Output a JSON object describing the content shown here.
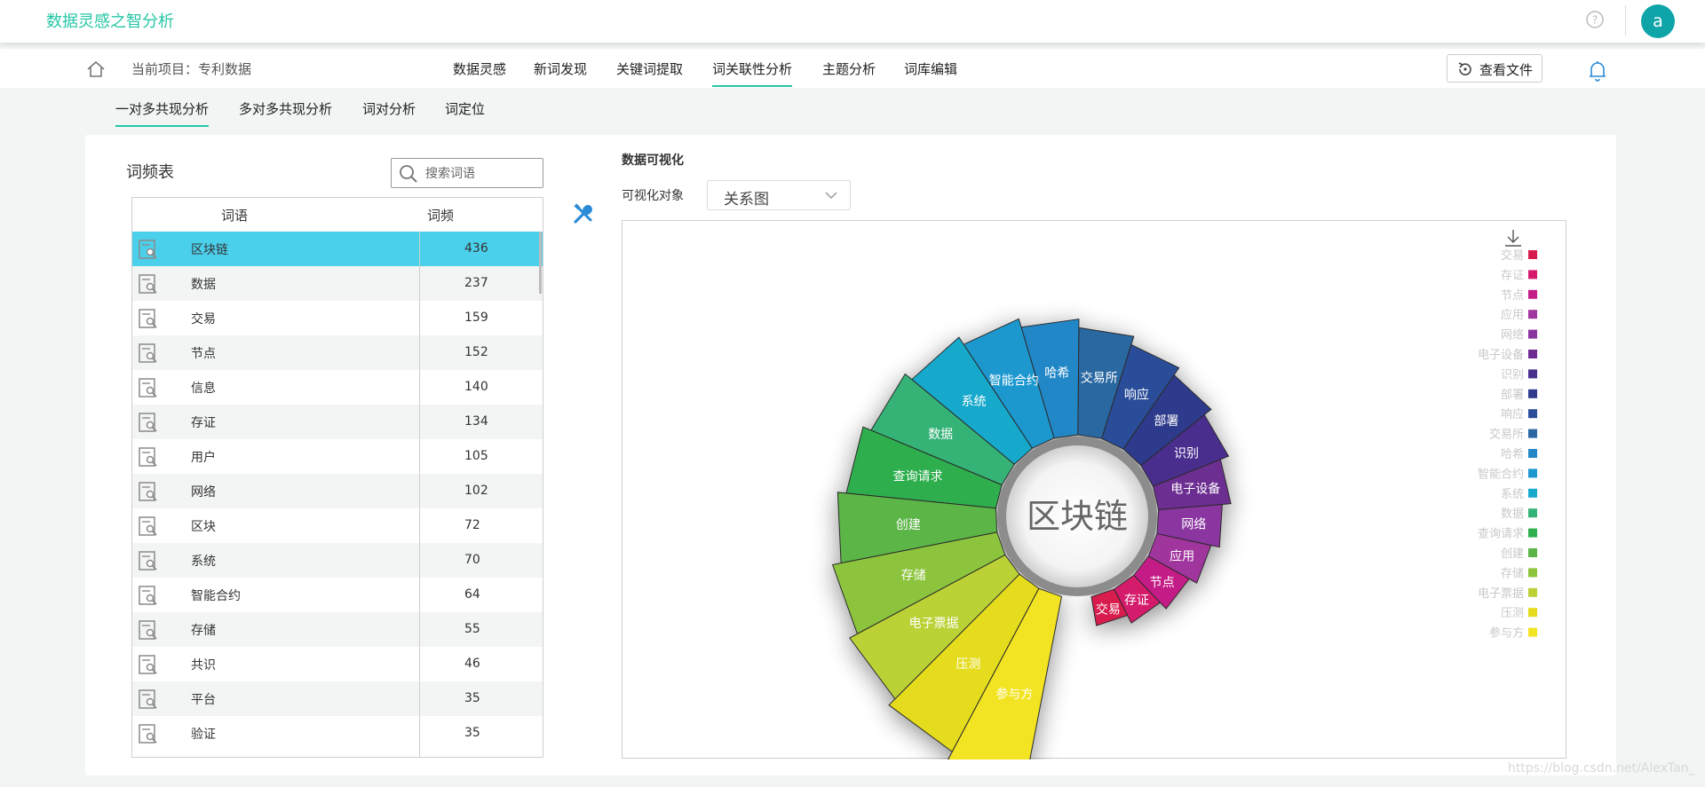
{
  "app": {
    "title": "数据灵感之智分析",
    "user_initial": "a"
  },
  "nav": {
    "current_project": "当前项目：专利数据",
    "tabs": [
      "数据灵感",
      "新词发现",
      "关键词提取",
      "词关联性分析",
      "主题分析",
      "词库编辑"
    ],
    "active_tab": "词关联性分析",
    "view_file_label": "查看文件"
  },
  "subtabs": {
    "items": [
      "一对多共现分析",
      "多对多共现分析",
      "词对分析",
      "词定位"
    ],
    "active": "一对多共现分析"
  },
  "word_freq": {
    "title": "词频表",
    "search_placeholder": "搜索词语",
    "columns": [
      "词语",
      "词频"
    ],
    "rows": [
      {
        "word": "区块链",
        "count": "436"
      },
      {
        "word": "数据",
        "count": "237"
      },
      {
        "word": "交易",
        "count": "159"
      },
      {
        "word": "节点",
        "count": "152"
      },
      {
        "word": "信息",
        "count": "140"
      },
      {
        "word": "存证",
        "count": "134"
      },
      {
        "word": "用户",
        "count": "105"
      },
      {
        "word": "网络",
        "count": "102"
      },
      {
        "word": "区块",
        "count": "72"
      },
      {
        "word": "系统",
        "count": "70"
      },
      {
        "word": "智能合约",
        "count": "64"
      },
      {
        "word": "存储",
        "count": "55"
      },
      {
        "word": "共识",
        "count": "46"
      },
      {
        "word": "平台",
        "count": "35"
      },
      {
        "word": "验证",
        "count": "35"
      }
    ],
    "selected_word": "区块链"
  },
  "viz": {
    "title": "数据可视化",
    "target_label": "可视化对象",
    "target_value": "关系图"
  },
  "chart_data": {
    "type": "nightingale-rose",
    "center_label": "区块链",
    "slices": [
      {
        "label": "交易",
        "color": "#d81b4e"
      },
      {
        "label": "存证",
        "color": "#d51a6c"
      },
      {
        "label": "节点",
        "color": "#c41d86"
      },
      {
        "label": "应用",
        "color": "#a0369e"
      },
      {
        "label": "网络",
        "color": "#8a34a0"
      },
      {
        "label": "电子设备",
        "color": "#6d2d92"
      },
      {
        "label": "识别",
        "color": "#4a2f8e"
      },
      {
        "label": "部署",
        "color": "#2e3a8c"
      },
      {
        "label": "响应",
        "color": "#2a4e9a"
      },
      {
        "label": "交易所",
        "color": "#2a67a2"
      },
      {
        "label": "哈希",
        "color": "#2387c6"
      },
      {
        "label": "智能合约",
        "color": "#1c98cf"
      },
      {
        "label": "系统",
        "color": "#16a9cb"
      },
      {
        "label": "数据",
        "color": "#34b377"
      },
      {
        "label": "查询请求",
        "color": "#2fae4e"
      },
      {
        "label": "创建",
        "color": "#5bb546"
      },
      {
        "label": "存储",
        "color": "#8cc43c"
      },
      {
        "label": "电子票据",
        "color": "#bcd136"
      },
      {
        "label": "压测",
        "color": "#e4dc1a"
      },
      {
        "label": "参与方",
        "color": "#f2e424"
      }
    ],
    "legend_position": "right"
  },
  "watermark": "https://blog.csdn.net/AlexTan_"
}
